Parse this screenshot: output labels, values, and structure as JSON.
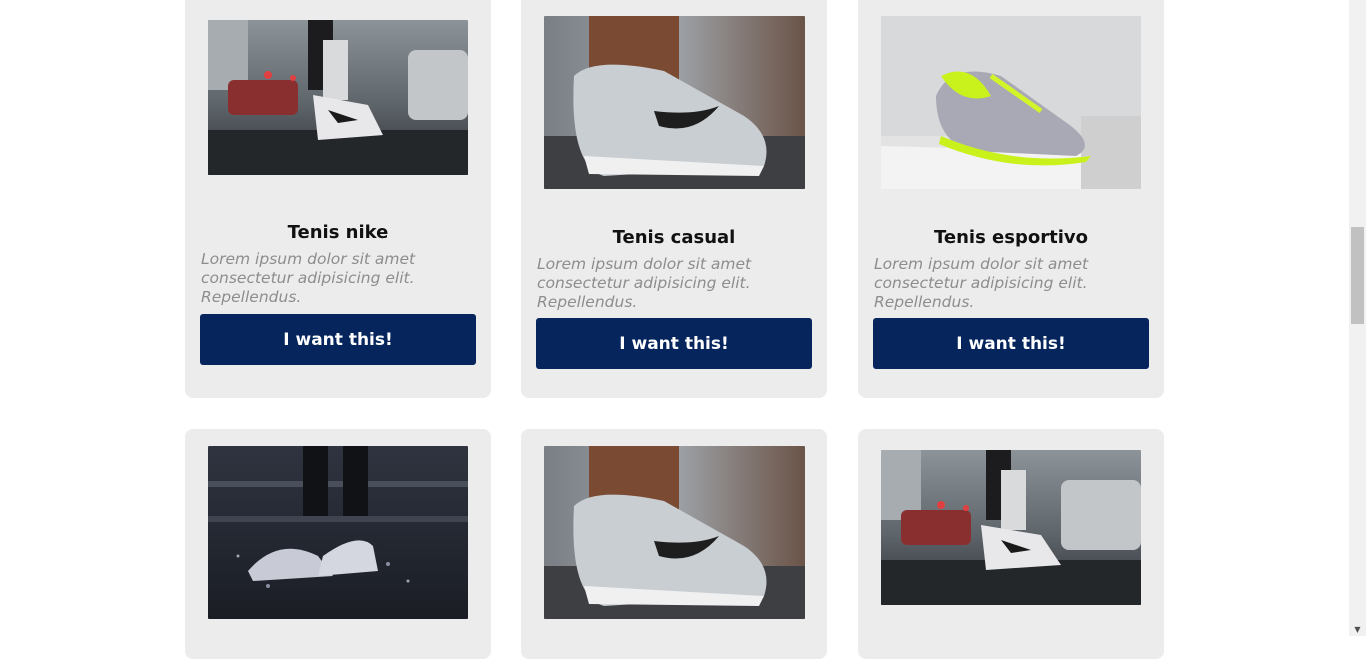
{
  "products": [
    {
      "title": "Tenis nike",
      "description": "Lorem ipsum dolor sit amet consectetur adipisicing elit. Repellendus.",
      "button_label": "I want this!"
    },
    {
      "title": "Tenis casual",
      "description": "Lorem ipsum dolor sit amet consectetur adipisicing elit. Repellendus.",
      "button_label": "I want this!"
    },
    {
      "title": "Tenis esportivo",
      "description": "Lorem ipsum dolor sit amet consectetur adipisicing elit. Repellendus.",
      "button_label": "I want this!"
    }
  ],
  "scrollbar": {
    "down_arrow_icon": "chevron-down-icon"
  },
  "colors": {
    "card_bg": "#ececec",
    "button_bg": "#05255c",
    "button_text": "#ffffff",
    "description_text": "#8d8d8d"
  }
}
